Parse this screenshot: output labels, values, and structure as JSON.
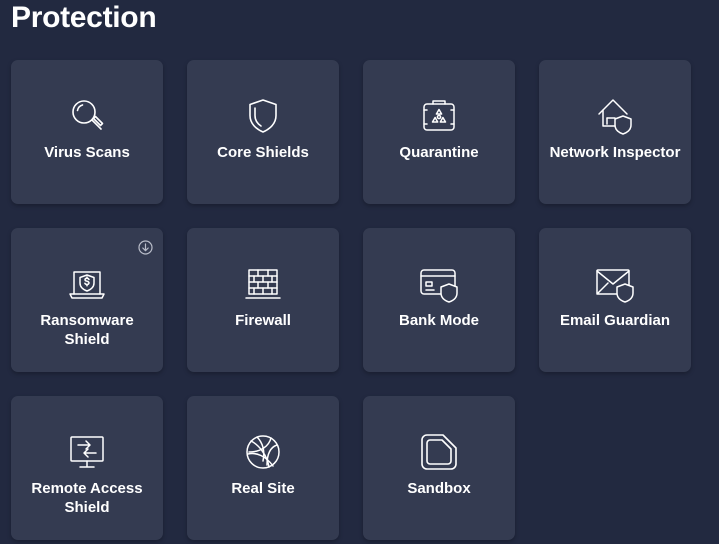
{
  "page": {
    "title": "Protection"
  },
  "colors": {
    "background": "#222940",
    "tile": "#343b51",
    "text": "#ffffff",
    "icon_stroke": "#ffffff"
  },
  "tiles": [
    {
      "label": "Virus Scans",
      "icon": "magnifier-icon"
    },
    {
      "label": "Core Shields",
      "icon": "shield-icon"
    },
    {
      "label": "Quarantine",
      "icon": "biohazard-chest-icon"
    },
    {
      "label": "Network Inspector",
      "icon": "house-shield-icon"
    },
    {
      "label": "Ransomware Shield",
      "icon": "laptop-dollar-shield-icon",
      "badge": "download-icon"
    },
    {
      "label": "Firewall",
      "icon": "brick-wall-icon"
    },
    {
      "label": "Bank Mode",
      "icon": "card-shield-icon"
    },
    {
      "label": "Email Guardian",
      "icon": "envelope-shield-icon"
    },
    {
      "label": "Remote Access Shield",
      "icon": "monitor-arrows-icon"
    },
    {
      "label": "Real Site",
      "icon": "globe-icon"
    },
    {
      "label": "Sandbox",
      "icon": "sandbox-square-icon"
    }
  ]
}
